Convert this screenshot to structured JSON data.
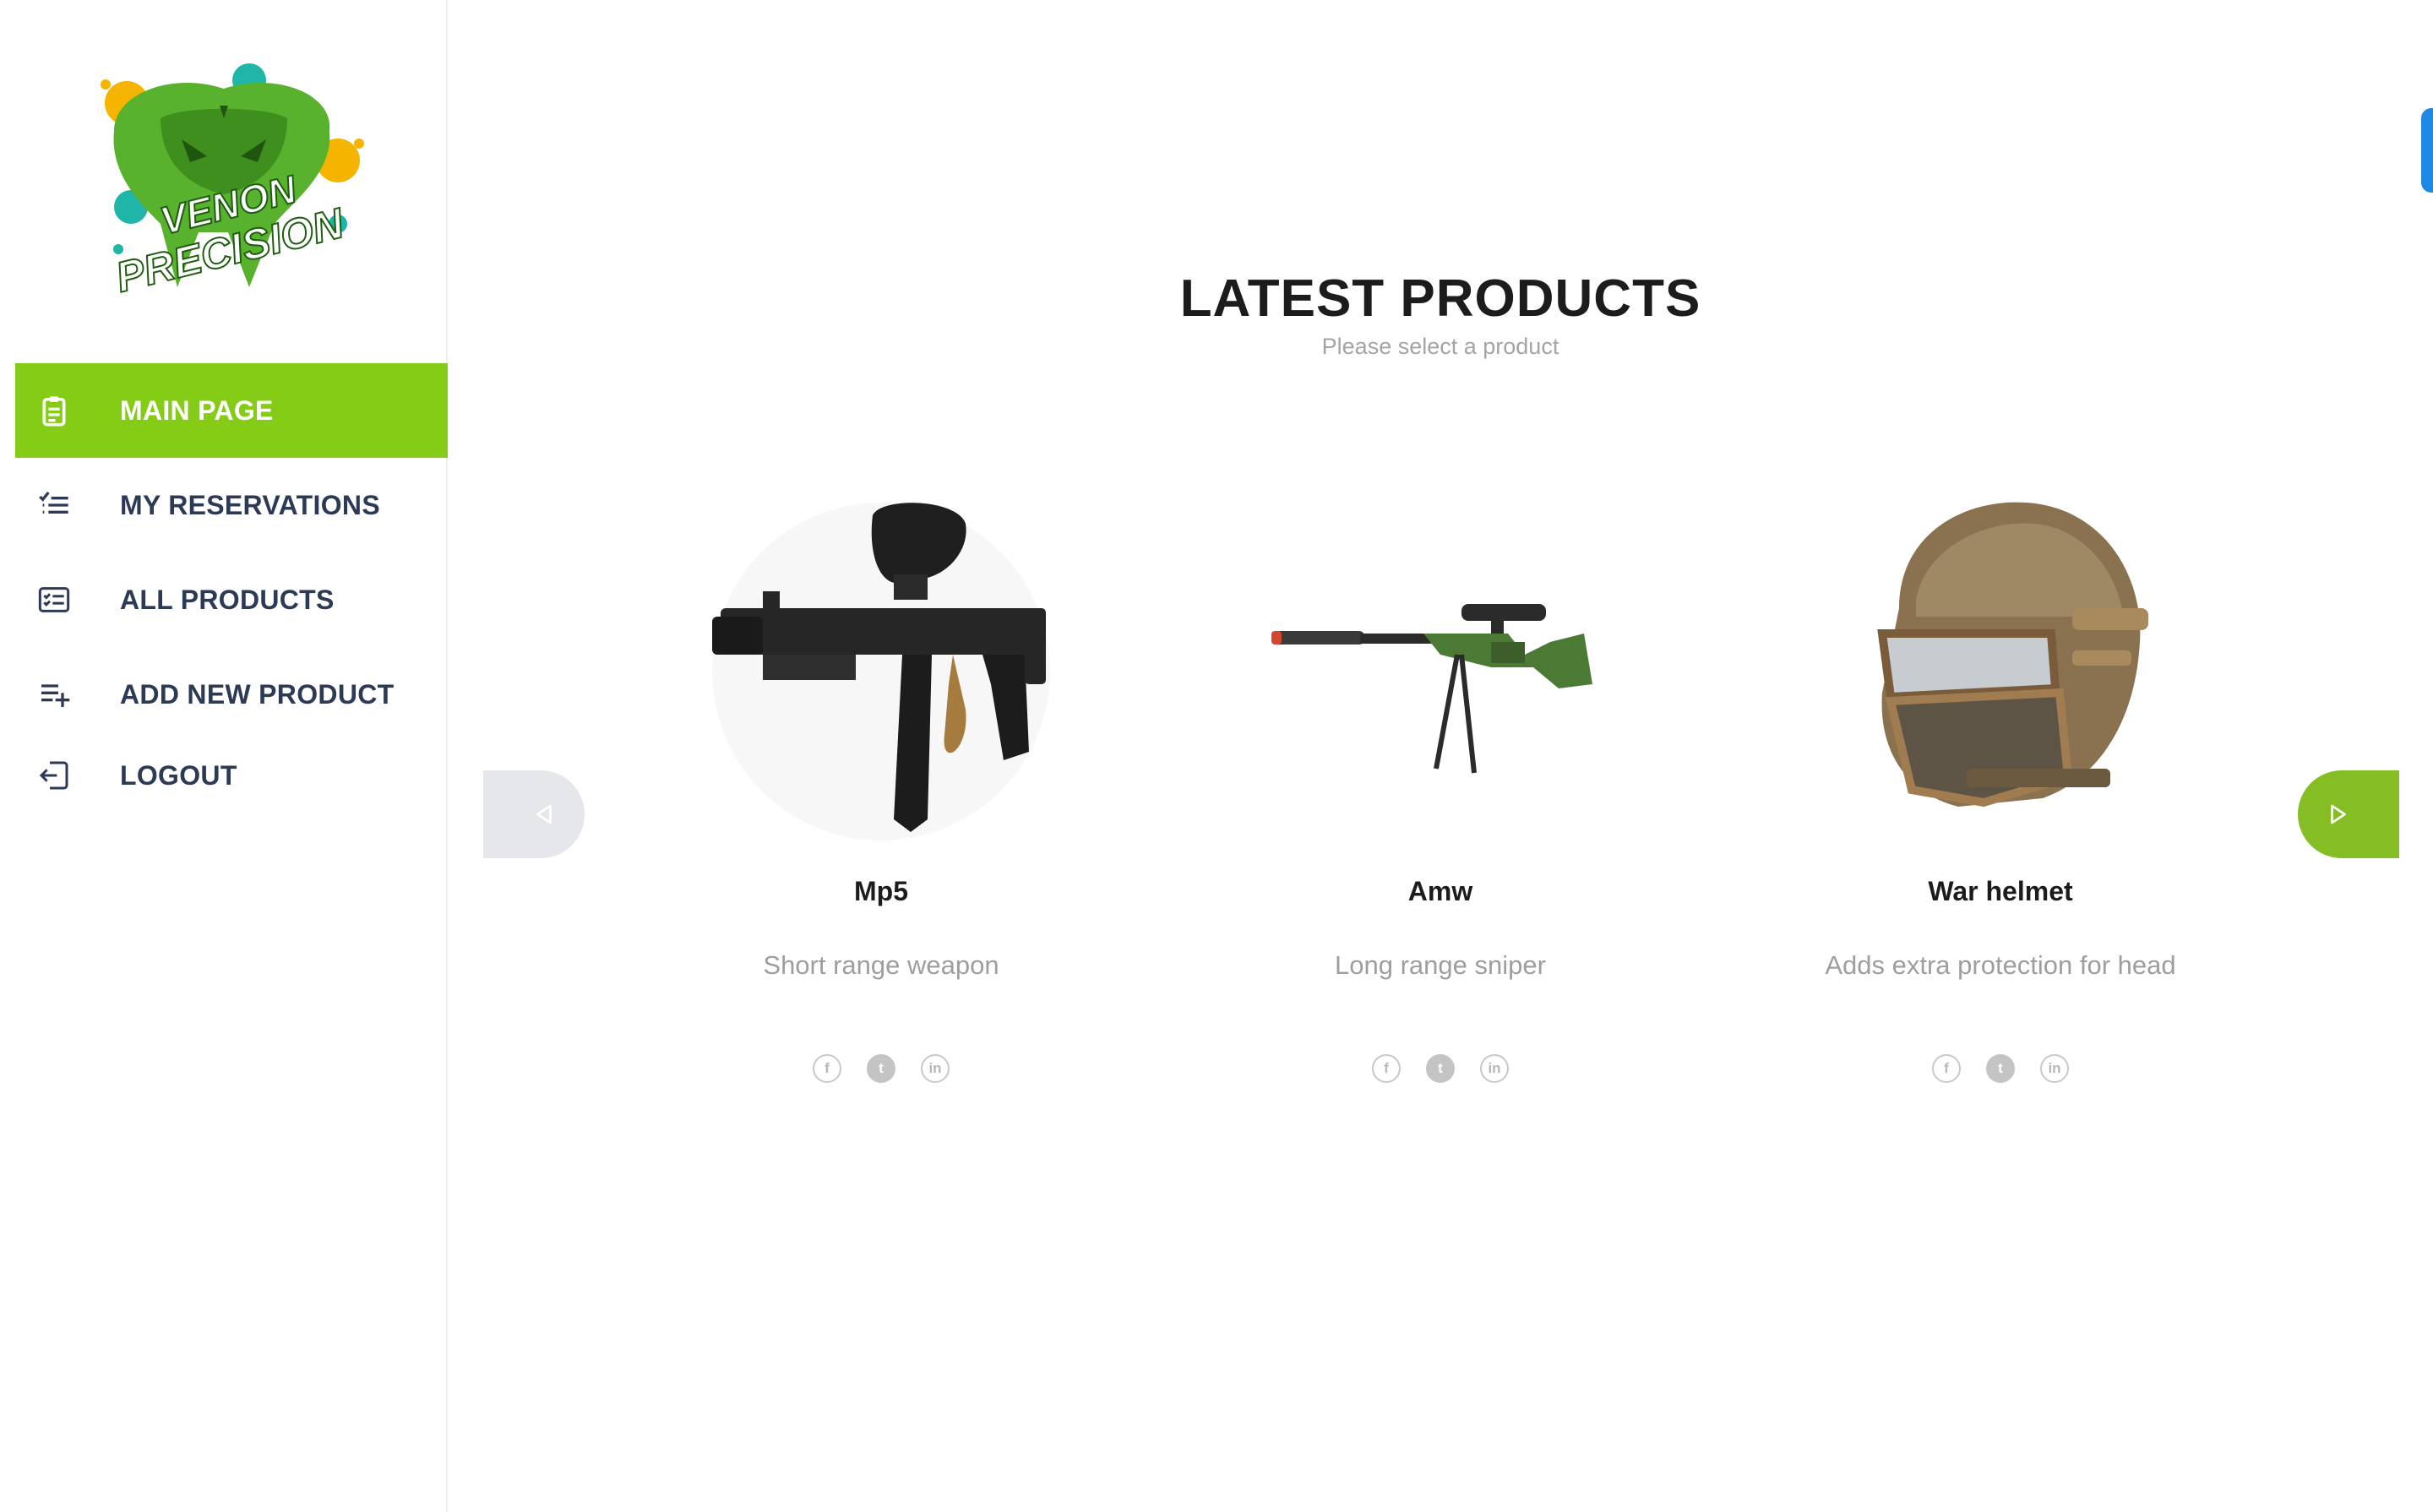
{
  "brand": {
    "logo_line1": "VENON",
    "logo_line2": "PRECISION"
  },
  "sidebar": {
    "items": [
      {
        "label": "MAIN PAGE",
        "icon": "clipboard-list-icon",
        "active": true
      },
      {
        "label": "MY RESERVATIONS",
        "icon": "checklist-icon",
        "active": false
      },
      {
        "label": "ALL PRODUCTS",
        "icon": "list-card-icon",
        "active": false
      },
      {
        "label": "ADD NEW PRODUCT",
        "icon": "playlist-add-icon",
        "active": false
      },
      {
        "label": "LOGOUT",
        "icon": "logout-icon",
        "active": false
      }
    ]
  },
  "main": {
    "title": "LATEST PRODUCTS",
    "subtitle": "Please select a product"
  },
  "products": [
    {
      "name": "Mp5",
      "description": "Short range weapon"
    },
    {
      "name": "Amw",
      "description": "Long range sniper"
    },
    {
      "name": "War helmet",
      "description": "Adds extra protection for head"
    }
  ],
  "social_icons": [
    "facebook-icon",
    "twitter-icon",
    "linkedin-icon"
  ],
  "colors": {
    "accent": "#84cc16",
    "nav_text": "#2d3a55",
    "next_arrow": "#84bd24",
    "prev_arrow": "#e6e7eb",
    "scroll_tab": "#1e88e5"
  }
}
